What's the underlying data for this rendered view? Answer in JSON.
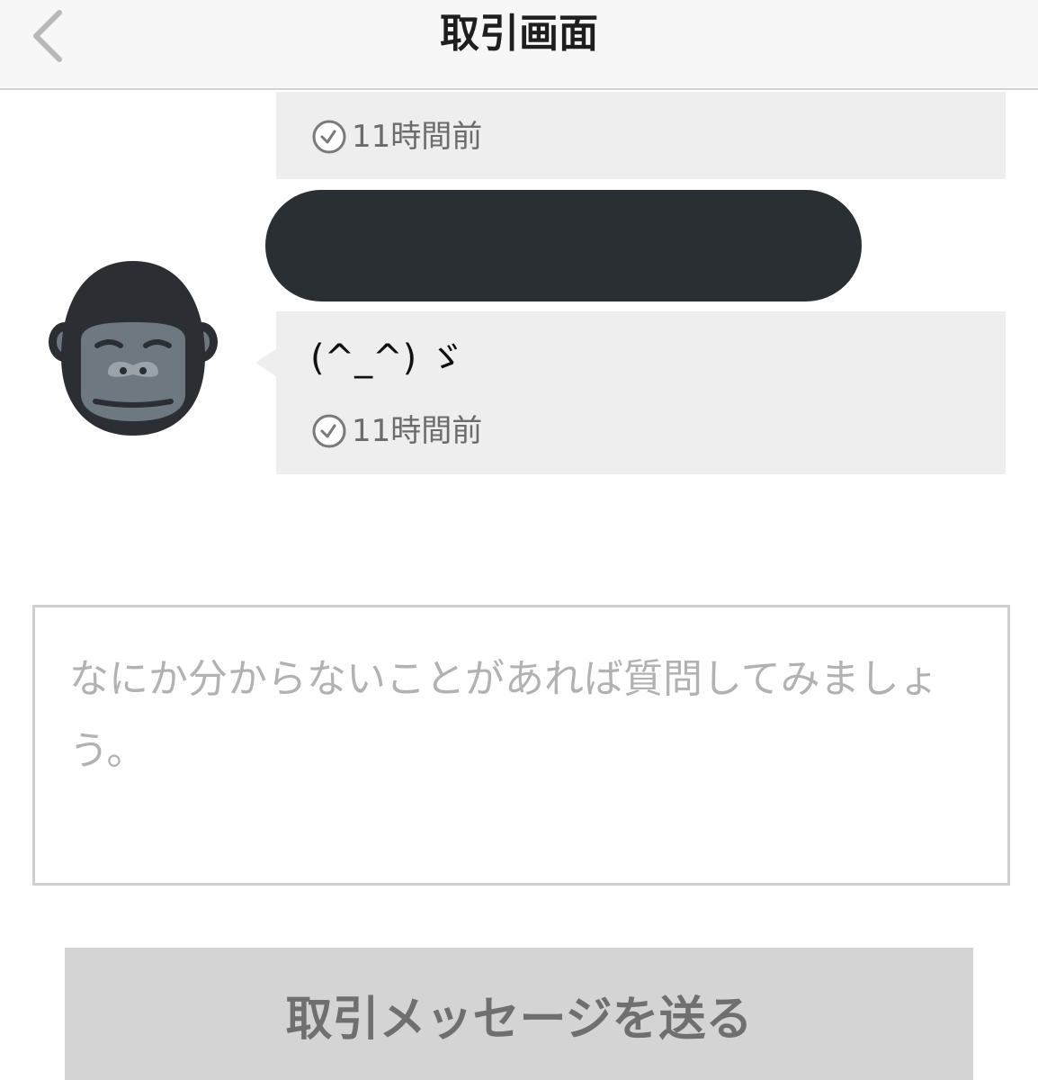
{
  "header": {
    "title": "取引画面",
    "back_icon": "chevron-left-icon"
  },
  "messages": [
    {
      "text": "",
      "time": "11時間前",
      "clock_icon": "clock-icon"
    },
    {
      "text": "(^_^) ゞ",
      "time": "11時間前",
      "clock_icon": "clock-icon"
    }
  ],
  "redacted_message": {
    "color": "#2a2f33"
  },
  "avatar": {
    "icon": "gorilla-icon"
  },
  "input": {
    "placeholder": "なにか分からないことがあれば質問してみましょう。"
  },
  "send_button": {
    "label": "取引メッセージを送る"
  },
  "colors": {
    "nav_bg": "#f7f7f7",
    "bubble_bg": "#eeeeee",
    "button_bg": "#d4d4d4",
    "button_text": "#6f6f6f",
    "placeholder_text": "#b2b2b2"
  }
}
